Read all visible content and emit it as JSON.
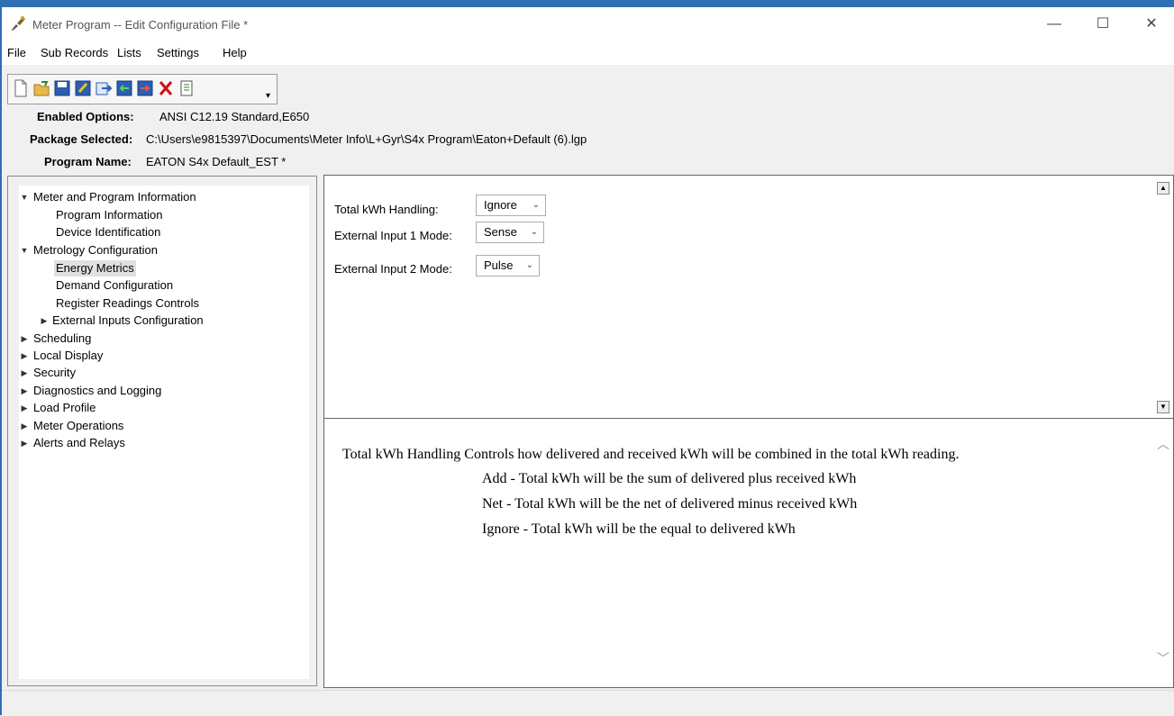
{
  "window": {
    "title": "Meter Program -- Edit Configuration File *",
    "controls": {
      "minimize": "—",
      "maximize": "☐",
      "close": "✕"
    }
  },
  "menu": [
    "File",
    "Sub Records",
    "Lists",
    "Settings",
    "Help"
  ],
  "toolbar": {
    "buttons": [
      "new-file-icon",
      "open-folder-icon",
      "save-icon",
      "edit-icon",
      "export-icon",
      "import-icon",
      "send-icon",
      "delete-icon",
      "clipboard-icon"
    ],
    "dropdown": "▾"
  },
  "info": {
    "enabled_options_label": "Enabled Options:",
    "enabled_options_value": "ANSI C12.19 Standard,E650",
    "package_label": "Package Selected:",
    "package_value": "C:\\Users\\e9815397\\Documents\\Meter Info\\L+Gyr\\S4x Program\\Eaton+Default (6).lgp",
    "program_label": "Program Name:",
    "program_value": "EATON S4x Default_EST *"
  },
  "tree": [
    {
      "label": "Meter and Program Information",
      "expander": "▼"
    },
    {
      "label": "Program Information",
      "expander": ""
    },
    {
      "label": "Device Identification",
      "expander": ""
    },
    {
      "label": "Metrology Configuration",
      "expander": "▼"
    },
    {
      "label": "Energy Metrics",
      "expander": ""
    },
    {
      "label": "Demand Configuration",
      "expander": ""
    },
    {
      "label": "Register Readings Controls",
      "expander": ""
    },
    {
      "label": "External Inputs Configuration",
      "expander": "▶"
    },
    {
      "label": "Scheduling",
      "expander": "▶"
    },
    {
      "label": "Local Display",
      "expander": "▶"
    },
    {
      "label": "Security",
      "expander": "▶"
    },
    {
      "label": "Diagnostics and Logging",
      "expander": "▶"
    },
    {
      "label": "Load Profile",
      "expander": "▶"
    },
    {
      "label": "Meter Operations",
      "expander": "▶"
    },
    {
      "label": "Alerts and Relays",
      "expander": "▶"
    }
  ],
  "props": [
    {
      "label": "Total kWh Handling:",
      "value": "Ignore"
    },
    {
      "label": "External Input 1 Mode:",
      "value": "Sense"
    },
    {
      "label": "External Input 2 Mode:",
      "value": "Pulse"
    }
  ],
  "description": [
    "Total kWh Handling Controls how delivered and received kWh will be combined in the total kWh reading.",
    "Add - Total kWh will be the sum of delivered plus received kWh",
    "Net - Total kWh will be the net of delivered minus received kWh",
    "Ignore - Total kWh will be the equal to delivered kWh"
  ]
}
